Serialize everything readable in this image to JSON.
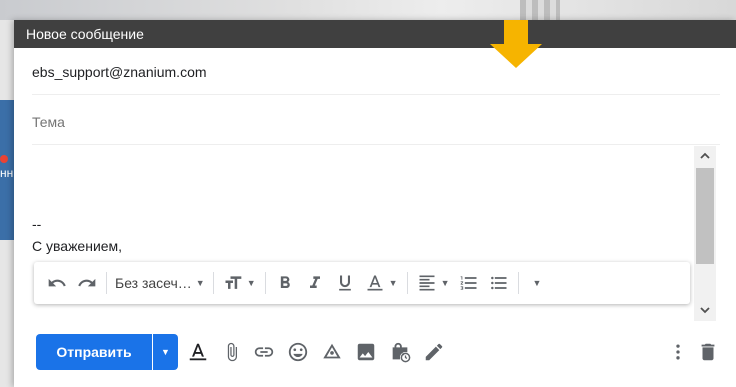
{
  "compose": {
    "title": "Новое сообщение",
    "to": "ebs_support@znanium.com",
    "subject_placeholder": "Тема",
    "signature_dash": "--",
    "signature_text": "С уважением,"
  },
  "background": {
    "partial_text": "нн"
  },
  "toolbar": {
    "font_label": "Без засеч…"
  },
  "bottom": {
    "send_label": "Отправить"
  },
  "colors": {
    "accent": "#1a73e8",
    "header": "#404040",
    "arrow": "#f6b400",
    "icon": "#5f6368"
  }
}
